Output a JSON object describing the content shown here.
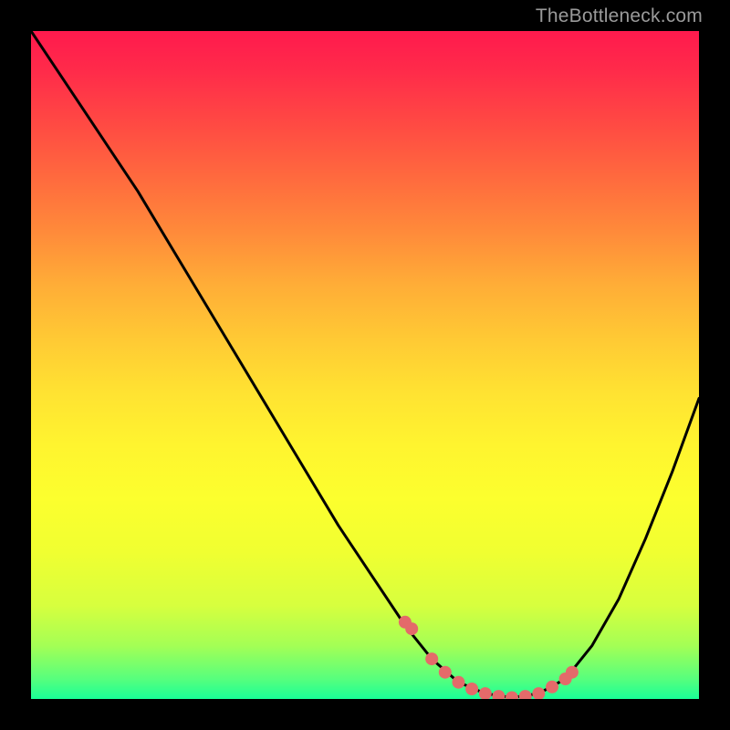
{
  "watermark": "TheBottleneck.com",
  "chart_data": {
    "type": "line",
    "title": "",
    "xlabel": "",
    "ylabel": "",
    "xlim": [
      0,
      100
    ],
    "ylim": [
      0,
      100
    ],
    "grid": false,
    "legend": false,
    "background_gradient": {
      "from": "#ff1a4d",
      "via": "#fff42f",
      "to": "#19ff97",
      "direction": "vertical"
    },
    "series": [
      {
        "name": "curve",
        "color": "#000000",
        "x": [
          0,
          4,
          10,
          16,
          22,
          28,
          34,
          40,
          46,
          52,
          56,
          60,
          64,
          68,
          72,
          76,
          80,
          84,
          88,
          92,
          96,
          100
        ],
        "y": [
          100,
          94,
          85,
          76,
          66,
          56,
          46,
          36,
          26,
          17,
          11,
          6,
          2.5,
          0.8,
          0.2,
          0.8,
          3,
          8,
          15,
          24,
          34,
          45
        ]
      },
      {
        "name": "dots",
        "color": "#e46a6a",
        "type": "scatter",
        "x": [
          56,
          57,
          60,
          62,
          64,
          66,
          68,
          70,
          72,
          74,
          76,
          78,
          80,
          81
        ],
        "y": [
          11.5,
          10.5,
          6,
          4,
          2.5,
          1.5,
          0.8,
          0.4,
          0.2,
          0.4,
          0.8,
          1.8,
          3,
          4
        ]
      }
    ]
  }
}
